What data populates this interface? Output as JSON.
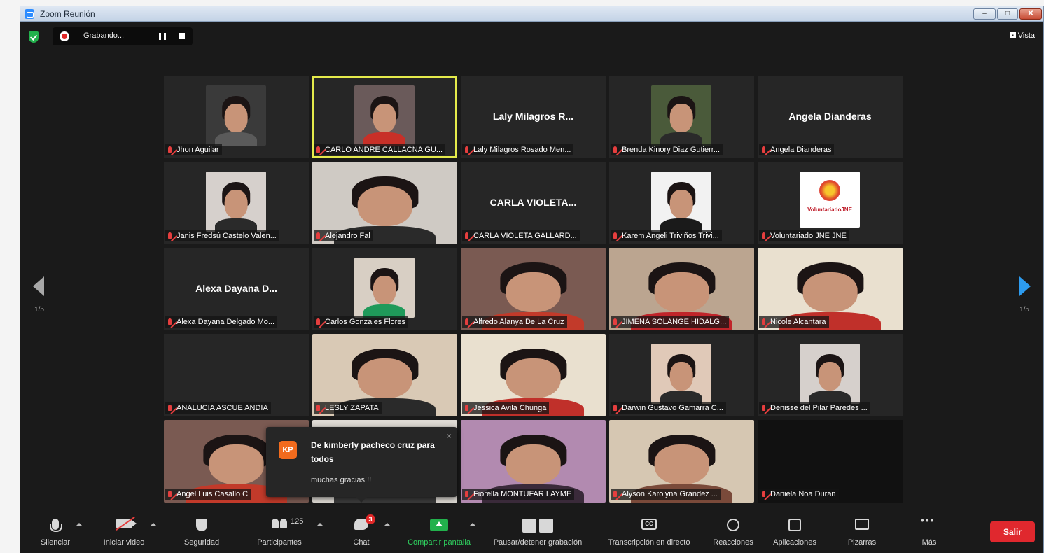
{
  "window": {
    "title": "Zoom Reunión"
  },
  "topbar": {
    "recording_label": "Grabando...",
    "view_label": "Vista"
  },
  "participants": [
    {
      "label": "Jhon Aguilar",
      "name_big": "",
      "video": "dark-elevator"
    },
    {
      "label": "CARLO ANDRE CALLACNA GU...",
      "name_big": "",
      "video": "red-shirt",
      "active_speaker": true
    },
    {
      "label": "Laly Milagros Rosado Men...",
      "name_big": "Laly Milagros R...",
      "video": "none"
    },
    {
      "label": "Brenda Kinory Diaz Gutierr...",
      "name_big": "",
      "video": "headset"
    },
    {
      "label": "Angela Dianderas",
      "name_big": "Angela Dianderas",
      "video": "none"
    },
    {
      "label": "Janis Fredsú Castelo Valen...",
      "name_big": "",
      "video": "small"
    },
    {
      "label": "Alejandro Fal",
      "name_big": "",
      "video": "full"
    },
    {
      "label": "CARLA VIOLETA GALLARD...",
      "name_big": "CARLA VIOLETA...",
      "video": "none"
    },
    {
      "label": "Karem Angeli Triviños Trivi...",
      "name_big": "",
      "video": "small-dark"
    },
    {
      "label": "Voluntariado JNE JNE",
      "name_big": "",
      "video": "logo",
      "logo_text": "VoluntariadoJNE"
    },
    {
      "label": "Alexa Dayana Delgado Mo...",
      "name_big": "Alexa Dayana D...",
      "video": "none"
    },
    {
      "label": "Carlos Gonzales Flores",
      "name_big": "",
      "video": "green-shirt"
    },
    {
      "label": "Alfredo Alanya De La Cruz",
      "name_big": "",
      "video": "full-room"
    },
    {
      "label": "JIMENA SOLANGE HIDALG...",
      "name_big": "",
      "video": "full-red"
    },
    {
      "label": "Nicole Alcantara",
      "name_big": "",
      "video": "full-light"
    },
    {
      "label": "ANALUCIA ASCUE ANDIA",
      "name_big": "",
      "video": "none"
    },
    {
      "label": "LESLY ZAPATA",
      "name_big": "",
      "video": "full-warm"
    },
    {
      "label": "Jessica Avila Chunga",
      "name_big": "",
      "video": "full-light"
    },
    {
      "label": "Darwin Gustavo Gamarra C...",
      "name_big": "",
      "video": "small-cap"
    },
    {
      "label": "Denisse del Pilar Paredes ...",
      "name_big": "",
      "video": "small"
    },
    {
      "label": "Angel Luis Casallo C",
      "name_big": "",
      "video": "full-room"
    },
    {
      "label": "",
      "name_big": "",
      "video": "covered"
    },
    {
      "label": "Fiorella MONTUFAR LAYME",
      "name_big": "",
      "video": "full-purple"
    },
    {
      "label": "Alyson Karolyna Grandez ...",
      "name_big": "",
      "video": "full-glasses"
    },
    {
      "label": "Daniela Noa Duran",
      "name_big": "",
      "video": "black"
    }
  ],
  "pagination": {
    "left": "1/5",
    "right": "1/5"
  },
  "chat_popup": {
    "avatar": "KP",
    "from": "De kimberly pacheco cruz para todos",
    "message": "muchas gracias!!!",
    "close": "×"
  },
  "toolbar": {
    "mute": "Silenciar",
    "start_video": "Iniciar video",
    "security": "Seguridad",
    "participants": "Participantes",
    "participants_count": "125",
    "chat": "Chat",
    "chat_badge": "3",
    "share_screen": "Compartir pantalla",
    "pause_recording": "Pausar/detener grabación",
    "transcription": "Transcripción en directo",
    "transcription_icon": "CC",
    "reactions": "Reacciones",
    "apps": "Aplicaciones",
    "whiteboards": "Pizarras",
    "more": "Más",
    "leave": "Salir"
  },
  "colors": {
    "active_speaker": "#e4ea4b",
    "share": "#22b14c",
    "leave": "#e0282e",
    "accent": "#2d9cf0"
  }
}
